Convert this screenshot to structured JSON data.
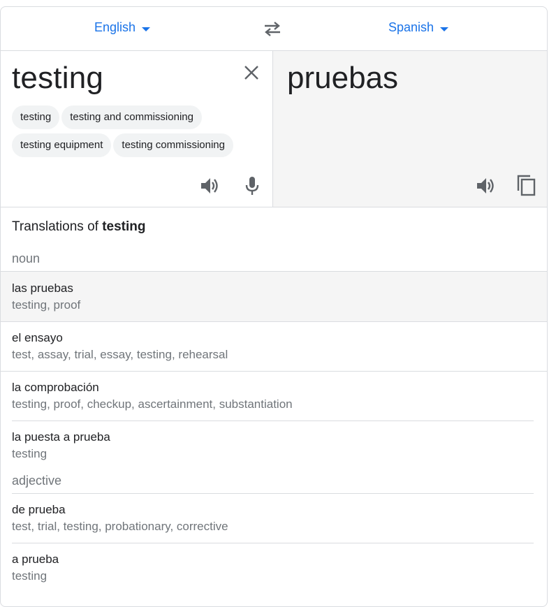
{
  "header": {
    "source_lang": "English",
    "target_lang": "Spanish"
  },
  "source": {
    "text": "testing",
    "suggestions": [
      "testing",
      "testing and commissioning",
      "testing equipment",
      "testing commissioning"
    ]
  },
  "target": {
    "text": "pruebas"
  },
  "dictionary": {
    "title_prefix": "Translations of ",
    "title_word": "testing",
    "groups": [
      {
        "pos": "noun",
        "entries": [
          {
            "word": "las pruebas",
            "synonyms": "testing, proof"
          },
          {
            "word": "el ensayo",
            "synonyms": "test, assay, trial, essay, testing, rehearsal"
          },
          {
            "word": "la comprobación",
            "synonyms": "testing, proof, checkup, ascertainment, substantiation"
          },
          {
            "word": "la puesta a prueba",
            "synonyms": "testing"
          }
        ]
      },
      {
        "pos": "adjective",
        "entries": [
          {
            "word": "de prueba",
            "synonyms": "test, trial, testing, probationary, corrective"
          },
          {
            "word": "a prueba",
            "synonyms": "testing"
          }
        ]
      }
    ]
  },
  "icons": {
    "swap": "swap-arrows-icon",
    "clear": "close-icon",
    "listen_source": "speaker-icon",
    "mic": "microphone-icon",
    "listen_target": "speaker-icon",
    "copy": "copy-icon"
  },
  "colors": {
    "accent": "#1a73e8",
    "icon": "#5f6368",
    "muted_text": "#70757a",
    "target_bg": "#f5f5f5",
    "highlight_row": "#f5f5f5"
  }
}
